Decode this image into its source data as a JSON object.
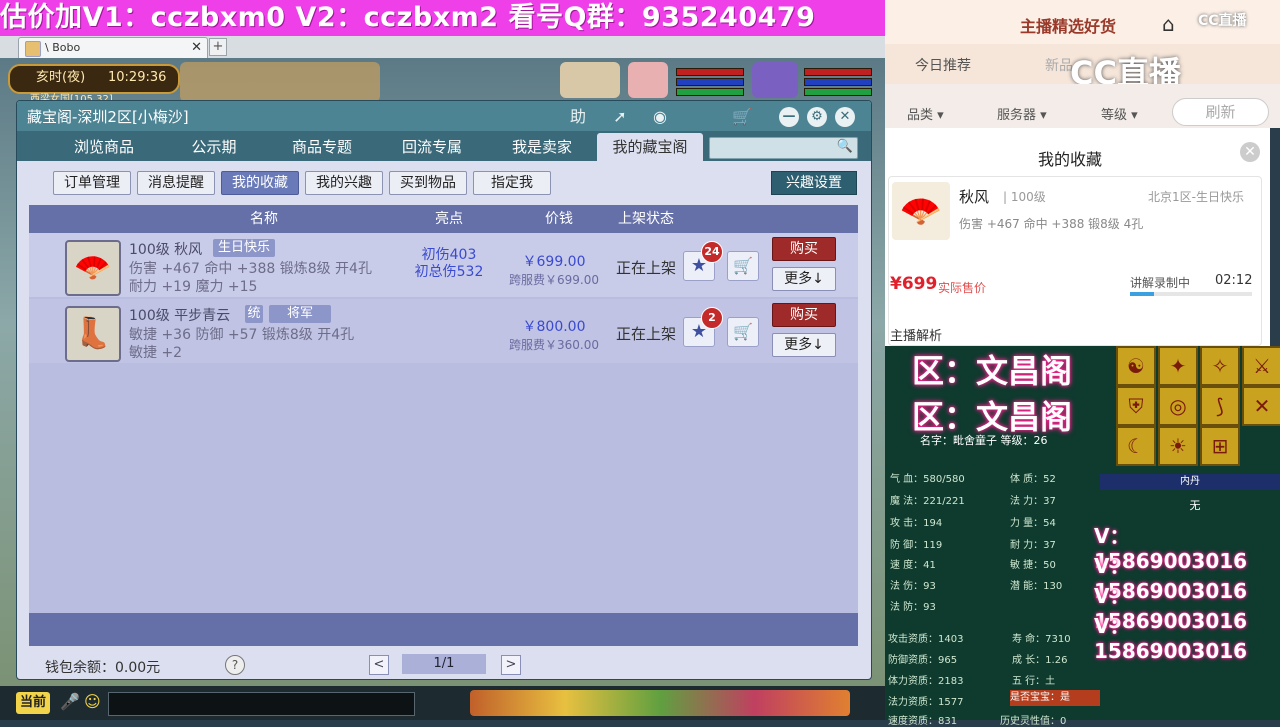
{
  "banner": {
    "text": "估价加V1：cczbxm0    V2：cczbxm2   看号Q群：935240479"
  },
  "browser": {
    "tab_title": "\\ Bobo",
    "close": "✕",
    "new_tab": "+"
  },
  "game": {
    "clock_period": "亥时(夜)",
    "clock_time": "10:29:36",
    "location": "西梁女国[105,32]",
    "current_channel": "当前"
  },
  "window": {
    "title": "藏宝阁-深圳2区[小梅沙]",
    "title_buttons": [
      "助",
      "—",
      "⚙",
      "✕"
    ],
    "tabs": [
      "浏览商品",
      "公示期",
      "商品专题",
      "回流专属",
      "我是卖家",
      "我的藏宝阁"
    ],
    "search_placeholder": "",
    "subtabs": [
      "订单管理",
      "消息提醒",
      "我的收藏",
      "我的兴趣",
      "买到物品",
      "指定我"
    ],
    "interest_button": "兴趣设置",
    "columns": [
      "名称",
      "亮点",
      "价钱",
      "上架状态"
    ],
    "rows": [
      {
        "icon": "folding-fan",
        "name": "100级  秋风",
        "tag": "生日快乐",
        "attr1": "伤害 +467  命中 +388  锻炼8级  开4孔",
        "attr2": "耐力 +19  魔力 +15",
        "highlight1": "初伤403",
        "highlight2": "初总伤532",
        "price": "￥699.00",
        "fee": "跨服费￥699.00",
        "status": "正在上架",
        "fav_count": "24",
        "buy": "购买",
        "more": "更多↓"
      },
      {
        "icon": "boots",
        "name": "100级  平步青云",
        "tag": "统",
        "tag2": "将军",
        "attr1": "敏捷 +36  防御 +57  锻炼8级  开4孔",
        "attr2": "敏捷 +2",
        "highlight1": "",
        "highlight2": "",
        "price": "￥800.00",
        "fee": "跨服费￥360.00",
        "status": "正在上架",
        "fav_count": "2",
        "buy": "购买",
        "more": "更多↓"
      }
    ],
    "wallet": "钱包余额：0.00元",
    "help": "?",
    "page": "1/1",
    "prev": "<",
    "next": ">"
  },
  "stream": {
    "header_title": "主播精选好货",
    "cc_small": "CC直播",
    "cc_logo": "CC直播",
    "tabs": [
      "今日推荐",
      "新品"
    ],
    "filters": [
      "品类 ▾",
      "服务器 ▾",
      "等级 ▾"
    ],
    "refresh": "刷新",
    "card_title": "我的收藏",
    "item_name": "秋风",
    "item_level": "| 100级",
    "item_server": "北京1区-生日快乐",
    "item_attr": "伤害 +467 命中 +388 锻8级 4孔",
    "item_price": "¥699",
    "item_price_label": "实际售价",
    "recording": "讲解录制中",
    "record_time": "02:12",
    "record_progress": 0.2,
    "analysis": "主播解析"
  },
  "pet": {
    "overlay1": "区：文昌阁",
    "overlay2": "区：文昌阁",
    "name_line": "名字：毗舍童子  等级：26",
    "neidan_title": "内丹",
    "neidan_value": "无",
    "stats_left": [
      "气   血：580/580",
      "魔   法：221/221",
      "攻   击：194",
      "防   御：119",
      "速   度：41",
      "法   伤：93",
      "法   防：93"
    ],
    "stats_right": [
      "体   质：52",
      "法   力：37",
      "力   量：54",
      "耐   力：37",
      "敏   捷：50",
      "潜   能：130"
    ],
    "stats_bottom_left": [
      "攻击资质：1403",
      "防御资质：965",
      "体力资质：2183",
      "法力资质：1577",
      "速度资质：831"
    ],
    "stats_bottom_right": [
      "寿   命：7310",
      "成   长：1.26",
      "五   行：土"
    ],
    "is_baby": "是否宝宝：是",
    "history": "历史灵性值：0",
    "contact": [
      "V：15869003016",
      "V：15869003016",
      "V：15869003016",
      "V：15869003016"
    ]
  }
}
